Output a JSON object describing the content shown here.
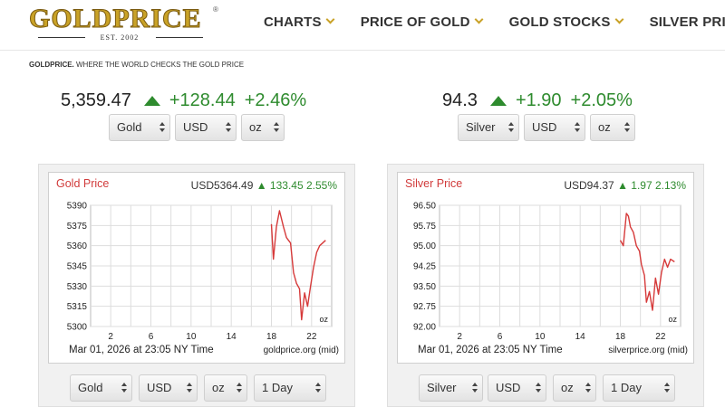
{
  "header": {
    "logo_text": "GOLDPRICE",
    "logo_reg": "®",
    "logo_est": "EST. 2002",
    "nav": [
      {
        "label": "CHARTS",
        "has_dropdown": true
      },
      {
        "label": "PRICE OF GOLD",
        "has_dropdown": true
      },
      {
        "label": "GOLD STOCKS",
        "has_dropdown": true
      },
      {
        "label": "SILVER PRICE",
        "has_dropdown": false
      }
    ]
  },
  "breadcrumb": {
    "brand": "GOLDPRICE.",
    "tagline": " WHERE THE WORLD CHECKS THE GOLD PRICE"
  },
  "gold_quote": {
    "price": "5,359.47",
    "change": "+128.44",
    "percent": "+2.46%",
    "direction": "up"
  },
  "silver_quote": {
    "price": "94.3",
    "change": "+1.90",
    "percent": "+2.05%",
    "direction": "up"
  },
  "top_selects": {
    "gold": {
      "metal": "Gold",
      "currency": "USD",
      "unit": "oz"
    },
    "silver": {
      "metal": "Silver",
      "currency": "USD",
      "unit": "oz"
    }
  },
  "colors": {
    "up": "#2e8b2e",
    "title_red": "#d13b3b",
    "line": "#d63a3a",
    "accent_gold": "#c9a227"
  },
  "charts": [
    {
      "id": "gold",
      "title": "Gold Price",
      "quote_price": "USD5364.49",
      "quote_change": "▲ 133.45 2.55%",
      "unit_label": "oz",
      "timestamp": "Mar 01, 2026 at 23:05 NY Time",
      "source": "goldprice.org (mid)",
      "selects": {
        "metal": "Gold",
        "currency": "USD",
        "unit": "oz",
        "range": "1 Day"
      }
    },
    {
      "id": "silver",
      "title": "Silver Price",
      "quote_price": "USD94.37",
      "quote_change": "▲ 1.97 2.13%",
      "unit_label": "oz",
      "timestamp": "Mar 01, 2026 at 23:05 NY Time",
      "source": "silverprice.org (mid)",
      "selects": {
        "metal": "Silver",
        "currency": "USD",
        "unit": "oz",
        "range": "1 Day"
      }
    }
  ],
  "chart_data": [
    {
      "type": "line",
      "title": "Gold Price",
      "xlabel": "",
      "ylabel": "",
      "x_ticks": [
        "2",
        "6",
        "10",
        "14",
        "18",
        "22"
      ],
      "y_ticks": [
        "5390",
        "5375",
        "5360",
        "5345",
        "5330",
        "5315",
        "5300"
      ],
      "xlim": [
        0,
        24
      ],
      "ylim": [
        5300,
        5390
      ],
      "grid": true,
      "series": [
        {
          "x": [
            18.0,
            18.2,
            18.5,
            18.8,
            19.2,
            19.5,
            19.9,
            20.2,
            20.5,
            20.8,
            21.0,
            21.3,
            21.6,
            21.9,
            22.2,
            22.5,
            22.8,
            23.1,
            23.4
          ],
          "y": [
            5376,
            5350,
            5374,
            5386,
            5374,
            5366,
            5362,
            5340,
            5332,
            5328,
            5305,
            5325,
            5315,
            5330,
            5344,
            5355,
            5360,
            5362,
            5364
          ]
        }
      ]
    },
    {
      "type": "line",
      "title": "Silver Price",
      "xlabel": "",
      "ylabel": "",
      "x_ticks": [
        "2",
        "6",
        "10",
        "14",
        "18",
        "22"
      ],
      "y_ticks": [
        "96.50",
        "95.75",
        "95.00",
        "94.25",
        "93.50",
        "92.75",
        "92.00"
      ],
      "xlim": [
        0,
        24
      ],
      "ylim": [
        92.0,
        96.5
      ],
      "grid": true,
      "series": [
        {
          "x": [
            18.0,
            18.3,
            18.6,
            18.8,
            19.0,
            19.3,
            19.6,
            19.9,
            20.1,
            20.4,
            20.6,
            20.9,
            21.2,
            21.5,
            21.8,
            22.1,
            22.4,
            22.7,
            23.0,
            23.4
          ],
          "y": [
            95.2,
            95.0,
            96.2,
            96.1,
            95.7,
            95.5,
            95.0,
            94.8,
            94.3,
            93.9,
            92.9,
            93.3,
            92.6,
            93.8,
            93.2,
            94.0,
            94.5,
            94.2,
            94.5,
            94.4
          ]
        }
      ]
    }
  ]
}
